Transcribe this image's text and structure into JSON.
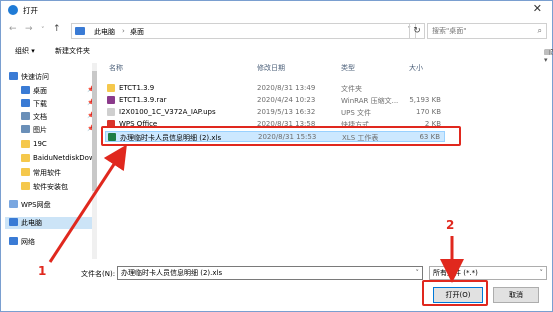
{
  "window": {
    "title": "打开"
  },
  "nav": {
    "back": "←",
    "forward": "→",
    "up_dd": "˅",
    "up": "↑",
    "crumbs": [
      "此电脑",
      "›",
      "桌面"
    ],
    "refresh": "↻",
    "search_placeholder": "搜索\"桌面\""
  },
  "toolbar": {
    "organize": "组织 ▾",
    "new_folder": "新建文件夹"
  },
  "sidebar": {
    "items": [
      {
        "label": "快速访问",
        "icon": "star-icon",
        "color": "#3a7bd5"
      },
      {
        "label": "桌面",
        "icon": "desktop-icon",
        "color": "#3a7bd5",
        "pin": "📌"
      },
      {
        "label": "下载",
        "icon": "download-icon",
        "color": "#3a7bd5",
        "pin": "📌"
      },
      {
        "label": "文档",
        "icon": "document-icon",
        "color": "#6a8fb8",
        "pin": "📌"
      },
      {
        "label": "图片",
        "icon": "picture-icon",
        "color": "#6a8fb8",
        "pin": "📌"
      },
      {
        "label": "19C",
        "icon": "folder-icon",
        "color": "#f5c84c"
      },
      {
        "label": "BaiduNetdiskDow",
        "icon": "folder-icon",
        "color": "#f5c84c"
      },
      {
        "label": "常用软件",
        "icon": "folder-icon",
        "color": "#f5c84c"
      },
      {
        "label": "软件安装包",
        "icon": "folder-icon",
        "color": "#f5c84c"
      },
      {
        "label": "WPS网盘",
        "icon": "cloud-icon",
        "color": "#7aa7e0"
      },
      {
        "label": "此电脑",
        "icon": "computer-icon",
        "color": "#3a7bd5"
      },
      {
        "label": "网络",
        "icon": "network-icon",
        "color": "#3a7bd5"
      }
    ]
  },
  "columns": {
    "name": "名称",
    "modified": "修改日期",
    "type": "类型",
    "size": "大小"
  },
  "files": [
    {
      "name": "ETCT1.3.9",
      "modified": "2020/8/31 13:49",
      "type": "文件夹",
      "size": "",
      "color": "#f5c84c",
      "icon": "folder-icon"
    },
    {
      "name": "ETCT1.3.9.rar",
      "modified": "2020/4/24 10:23",
      "type": "WinRAR 压缩文...",
      "size": "5,193 KB",
      "color": "#8b3a8b",
      "icon": "rar-icon"
    },
    {
      "name": "I2X0100_1C_V372A_IAP.ups",
      "modified": "2019/5/13 16:32",
      "type": "UPS 文件",
      "size": "170 KB",
      "color": "#cfcfcf",
      "icon": "file-icon"
    },
    {
      "name": "WPS Office",
      "modified": "2020/8/31 13:58",
      "type": "快捷方式",
      "size": "2 KB",
      "color": "#d9342b",
      "icon": "wps-icon"
    },
    {
      "name": "办理临时卡人员信息明细 (2).xls",
      "modified": "2020/8/31 15:53",
      "type": "XLS 工作表",
      "size": "63 KB",
      "color": "#1e7e45",
      "icon": "xls-icon"
    }
  ],
  "bottom": {
    "filename_label": "文件名(N):",
    "filename_value": "办理临时卡人员信息明细 (2).xls",
    "filetype_value": "所有文件 (*.*)",
    "open_button": "打开(O)",
    "cancel_button": "取消"
  },
  "annotations": {
    "one": "1",
    "two": "2"
  },
  "accent": "#e0281e"
}
